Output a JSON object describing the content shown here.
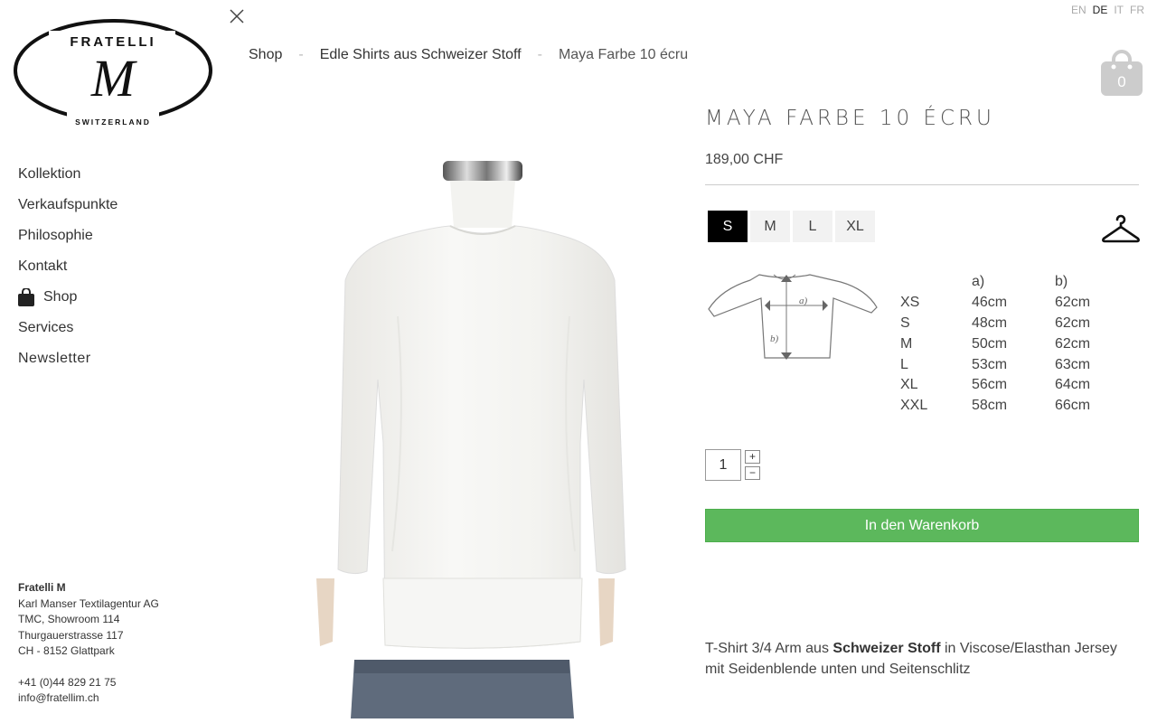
{
  "logo": {
    "brand": "FRATELLI",
    "letter": "M",
    "sub": "SWITZERLAND"
  },
  "breadcrumb": {
    "items": [
      "Shop",
      "Edle Shirts aus Schweizer Stoff"
    ],
    "separator": "-",
    "current": "Maya Farbe 10 écru"
  },
  "languages": {
    "en": "EN",
    "de": "DE",
    "it": "IT",
    "fr": "FR",
    "active": "DE"
  },
  "cart": {
    "count": "0"
  },
  "nav": {
    "kollektion": "Kollektion",
    "verkaufspunkte": "Verkaufspunkte",
    "philosophie": "Philosophie",
    "kontakt": "Kontakt",
    "shop": "Shop",
    "services": "Services",
    "newsletter": "Newsletter"
  },
  "address": {
    "name": "Fratelli M",
    "company": "Karl Manser Textilagentur AG",
    "showroom": "TMC, Showroom 114",
    "street": "Thurgauerstrasse 117",
    "city": "CH - 8152 Glattpark",
    "phone": "+41 (0)44 829 21 75",
    "email": "info@fratellim.ch"
  },
  "product": {
    "title": "MAYA FARBE 10 ÉCRU",
    "price": "189,00 CHF",
    "sizes": [
      "S",
      "M",
      "L",
      "XL"
    ],
    "selected_size": "S",
    "quantity": "1",
    "plus": "+",
    "minus": "−",
    "add_to_cart": "In den Warenkorb",
    "desc_part1": "T-Shirt 3/4 Arm aus ",
    "desc_bold": "Schweizer Stoff",
    "desc_part2": " in Viscose/Elasthan Jersey mit Seidenblende unten und Seitenschlitz",
    "diagram_labels": {
      "a": "a)",
      "b": "b)"
    }
  },
  "size_table": {
    "header": [
      "",
      "a)",
      "b)"
    ],
    "rows": [
      [
        "XS",
        "46cm",
        "62cm"
      ],
      [
        "S",
        "48cm",
        "62cm"
      ],
      [
        "M",
        "50cm",
        "62cm"
      ],
      [
        "L",
        "53cm",
        "63cm"
      ],
      [
        "XL",
        "56cm",
        "64cm"
      ],
      [
        "XXL",
        "58cm",
        "66cm"
      ]
    ]
  },
  "colors": {
    "accent_green": "#5cb85c",
    "cart_gray": "#cccccc",
    "text": "#333333"
  }
}
